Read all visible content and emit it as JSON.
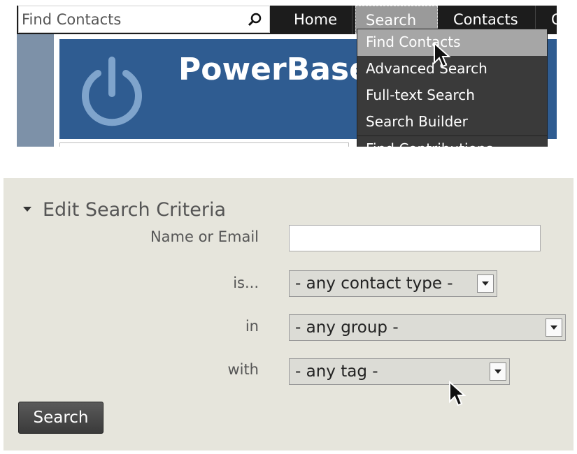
{
  "top": {
    "find_placeholder": "Find Contacts",
    "menu": [
      "Home",
      "Search",
      "Contacts",
      "C"
    ],
    "brand": "PowerBase",
    "search_dropdown": [
      "Find Contacts",
      "Advanced Search",
      "Full-text Search",
      "Search Builder",
      "Find Contributions"
    ],
    "hovered_item": "Find Contacts"
  },
  "form": {
    "title": "Edit Search Criteria",
    "labels": {
      "name_email": "Name or Email",
      "is": "is...",
      "in": "in",
      "with": "with"
    },
    "name_email_value": "",
    "contact_type": "- any contact type -",
    "group": "- any group -",
    "tag": "- any tag -",
    "search_button": "Search"
  },
  "colors": {
    "menubar": "#1c1c1c",
    "banner": "#2f5c91",
    "panel": "#e6e5dc",
    "button": "#4a4a4a"
  }
}
